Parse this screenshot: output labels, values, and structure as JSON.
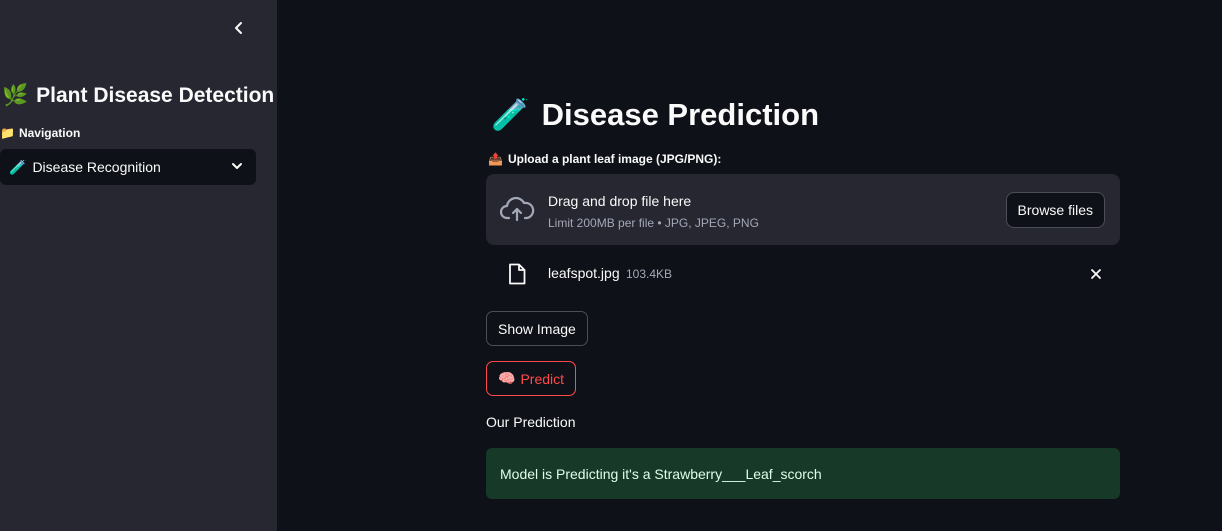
{
  "sidebar": {
    "title": "Plant Disease Detection",
    "title_emoji": "🌿",
    "nav_label": "Navigation",
    "nav_emoji": "📁",
    "select_value": "Disease Recognition",
    "select_emoji": "🧪"
  },
  "main": {
    "title": "Disease Prediction",
    "title_emoji": "🧪",
    "upload_label": "Upload a plant leaf image (JPG/PNG):",
    "upload_emoji": "📤",
    "dropzone": {
      "title": "Drag and drop file here",
      "subtitle": "Limit 200MB per file • JPG, JPEG, PNG",
      "browse_label": "Browse files"
    },
    "file": {
      "name": "leafspot.jpg",
      "size": "103.4KB"
    },
    "show_image_label": "Show Image",
    "predict_label": "Predict",
    "predict_emoji": "🧠",
    "prediction_heading": "Our Prediction",
    "prediction_text": "Model is Predicting it's a Strawberry___Leaf_scorch"
  },
  "icons": {
    "collapse": "chevron-left-icon",
    "select_arrow": "chevron-down-icon",
    "upload": "cloud-upload-icon",
    "file": "file-icon",
    "remove": "close-icon"
  },
  "colors": {
    "background": "#0e1117",
    "sidebar": "#262730",
    "accent": "#ff4b4b",
    "success_bg": "#173928",
    "success_text": "#dffde9"
  }
}
